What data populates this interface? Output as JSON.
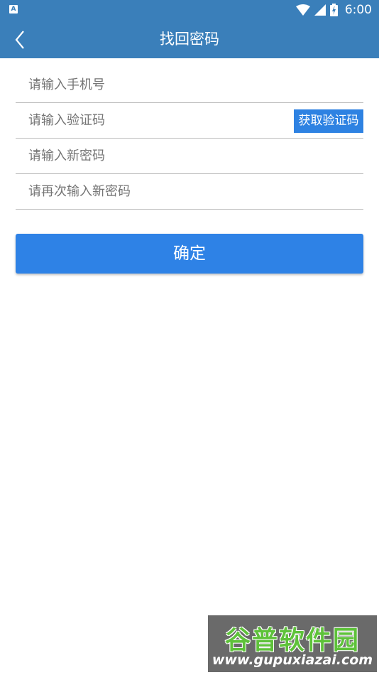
{
  "status_bar": {
    "app_icon_letter": "A",
    "time": "6:00"
  },
  "header": {
    "title": "找回密码"
  },
  "form": {
    "phone_placeholder": "请输入手机号",
    "code_placeholder": "请输入验证码",
    "get_code_label": "获取验证码",
    "new_password_placeholder": "请输入新密码",
    "confirm_password_placeholder": "请再次输入新密码"
  },
  "confirm_label": "确定",
  "watermark": {
    "title": "谷普软件园",
    "url": "www.gupuxiazai.com"
  },
  "colors": {
    "app_bar": "#3a7fba",
    "primary_button": "#2e82e6",
    "divider": "#bdbdbd"
  }
}
